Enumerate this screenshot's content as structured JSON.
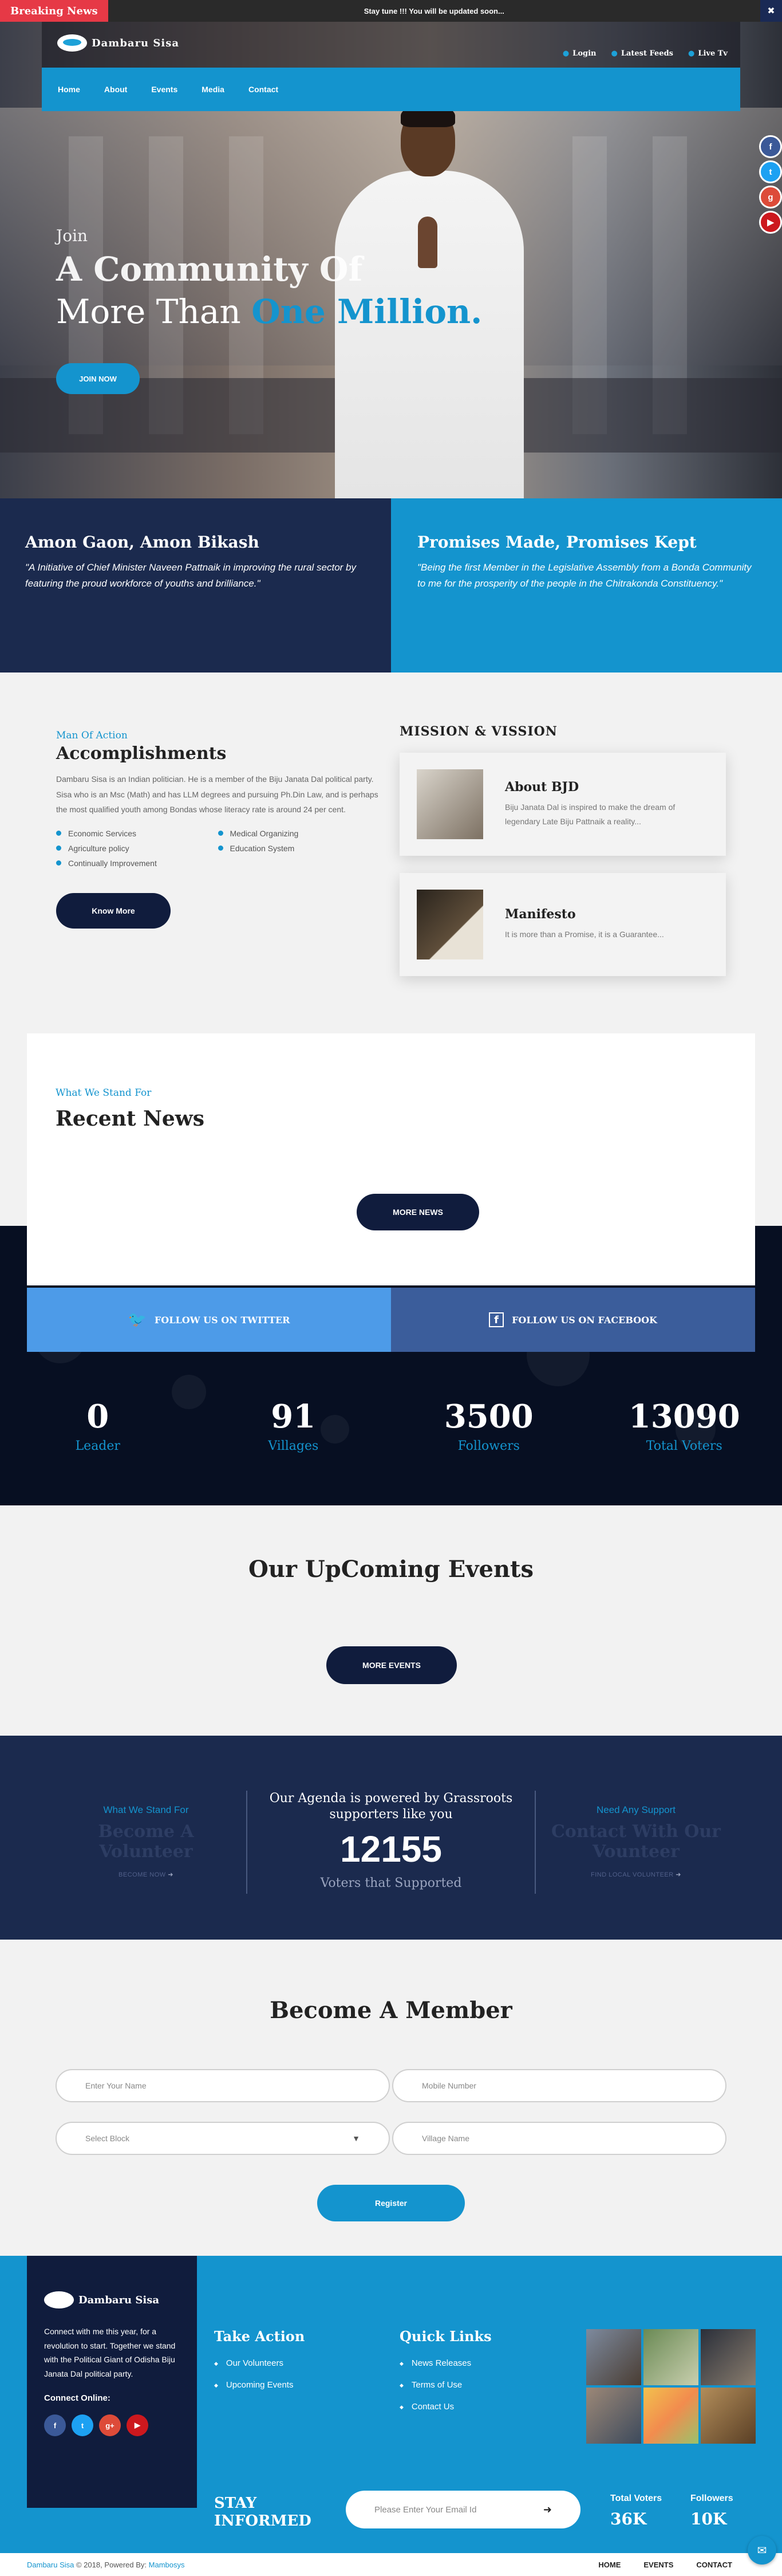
{
  "ticker": {
    "badge": "Breaking News",
    "message": "Stay tune !!! You will be updated soon...",
    "close": "✖"
  },
  "brand": {
    "name": "Dambaru Sisa"
  },
  "toplinks": {
    "login": "Login",
    "feeds": "Latest Feeds",
    "live": "Live Tv"
  },
  "nav": [
    "Home",
    "About",
    "Events",
    "Media",
    "Contact"
  ],
  "hero": {
    "join": "Join",
    "line1": "A Community Of",
    "line2_a": "More Than ",
    "line2_b": "One Million.",
    "cta": "JOIN NOW"
  },
  "promise": {
    "left_title": "Amon Gaon, Amon Bikash",
    "left_text": "\"A Initiative of Chief Minister Naveen Pattnaik in improving the rural sector by featuring the proud workforce of youths and brilliance.\"",
    "right_title": "Promises Made, Promises Kept",
    "right_text": "\"Being the first Member in the Legislative Assembly from a Bonda Community to me for the prosperity of the people in the Chitrakonda Constituency.\""
  },
  "accomplish": {
    "kicker": "Man Of Action",
    "title": "Accomplishments",
    "text": "Dambaru Sisa is an Indian politician. He is a member of the Biju Janata Dal political party. Sisa who is an Msc (Math) and has LLM degrees and pursuing Ph.Din Law, and is perhaps the most qualified youth among Bondas whose literacy rate is around 24 per cent.",
    "bullets": [
      "Economic Services",
      "Medical Organizing",
      "Agriculture policy",
      "Education System",
      "Continually Improvement"
    ],
    "cta": "Know More"
  },
  "mission": {
    "title": "MISSION & VISSION",
    "cards": [
      {
        "title": "About BJD",
        "text": "Biju Janata Dal is inspired to make the dream of legendary Late Biju Pattnaik a reality..."
      },
      {
        "title": "Manifesto",
        "text": "It is more than a Promise, it is a Guarantee..."
      }
    ]
  },
  "news": {
    "kicker": "What We Stand For",
    "title": "Recent News",
    "cta": "MORE NEWS"
  },
  "follow": {
    "twitter": "FOLLOW US ON TWITTER",
    "facebook": "FOLLOW US ON FACEBOOK"
  },
  "stats": [
    {
      "value": "0",
      "label": "Leader"
    },
    {
      "value": "91",
      "label": "Villages"
    },
    {
      "value": "3500",
      "label": "Followers"
    },
    {
      "value": "13090",
      "label": "Total Voters"
    }
  ],
  "events": {
    "title": "Our UpComing Events",
    "cta": "MORE EVENTS"
  },
  "agenda": {
    "left_kicker": "What We Stand For",
    "left_title": "Become A Volunteer",
    "left_link": "BECOME NOW",
    "mid_title": "Our Agenda is powered by Grassroots supporters like you",
    "mid_value": "12155",
    "mid_label": "Voters that Supported",
    "right_kicker": "Need Any Support",
    "right_title": "Contact With Our Vounteer",
    "right_link": "FIND LOCAL VOLUNTEER"
  },
  "member": {
    "title": "Become A Member",
    "name_ph": "Enter Your Name",
    "mobile_ph": "Mobile Number",
    "block_ph": "Select Block",
    "village_ph": "Village Name",
    "cta": "Register"
  },
  "footer": {
    "about": "Connect with me this year, for a revolution to start. Together we stand with the Political Giant of Odisha Biju Janata Dal political party.",
    "connect": "Connect Online:",
    "take_action": "Take Action",
    "take_items": [
      "Our Volunteers",
      "Upcoming Events"
    ],
    "quick_links": "Quick Links",
    "quick_items": [
      "News Releases",
      "Terms of Use",
      "Contact Us"
    ],
    "stay1": "STAY",
    "stay2": "INFORMED",
    "email_ph": "Please Enter Your Email Id",
    "voters_label": "Total Voters",
    "voters_value": "36K",
    "followers_label": "Followers",
    "followers_value": "10K"
  },
  "bottom": {
    "copy_a": "Dambaru Sisa",
    "copy_b": " © 2018, Powered By: ",
    "copy_c": "Mambosys",
    "links": [
      "HOME",
      "EVENTS",
      "CONTACT"
    ]
  },
  "colors": {
    "accent": "#1494ce",
    "navy": "#101c3d",
    "dark": "#1b2a4e",
    "breaking": "#e63946"
  }
}
